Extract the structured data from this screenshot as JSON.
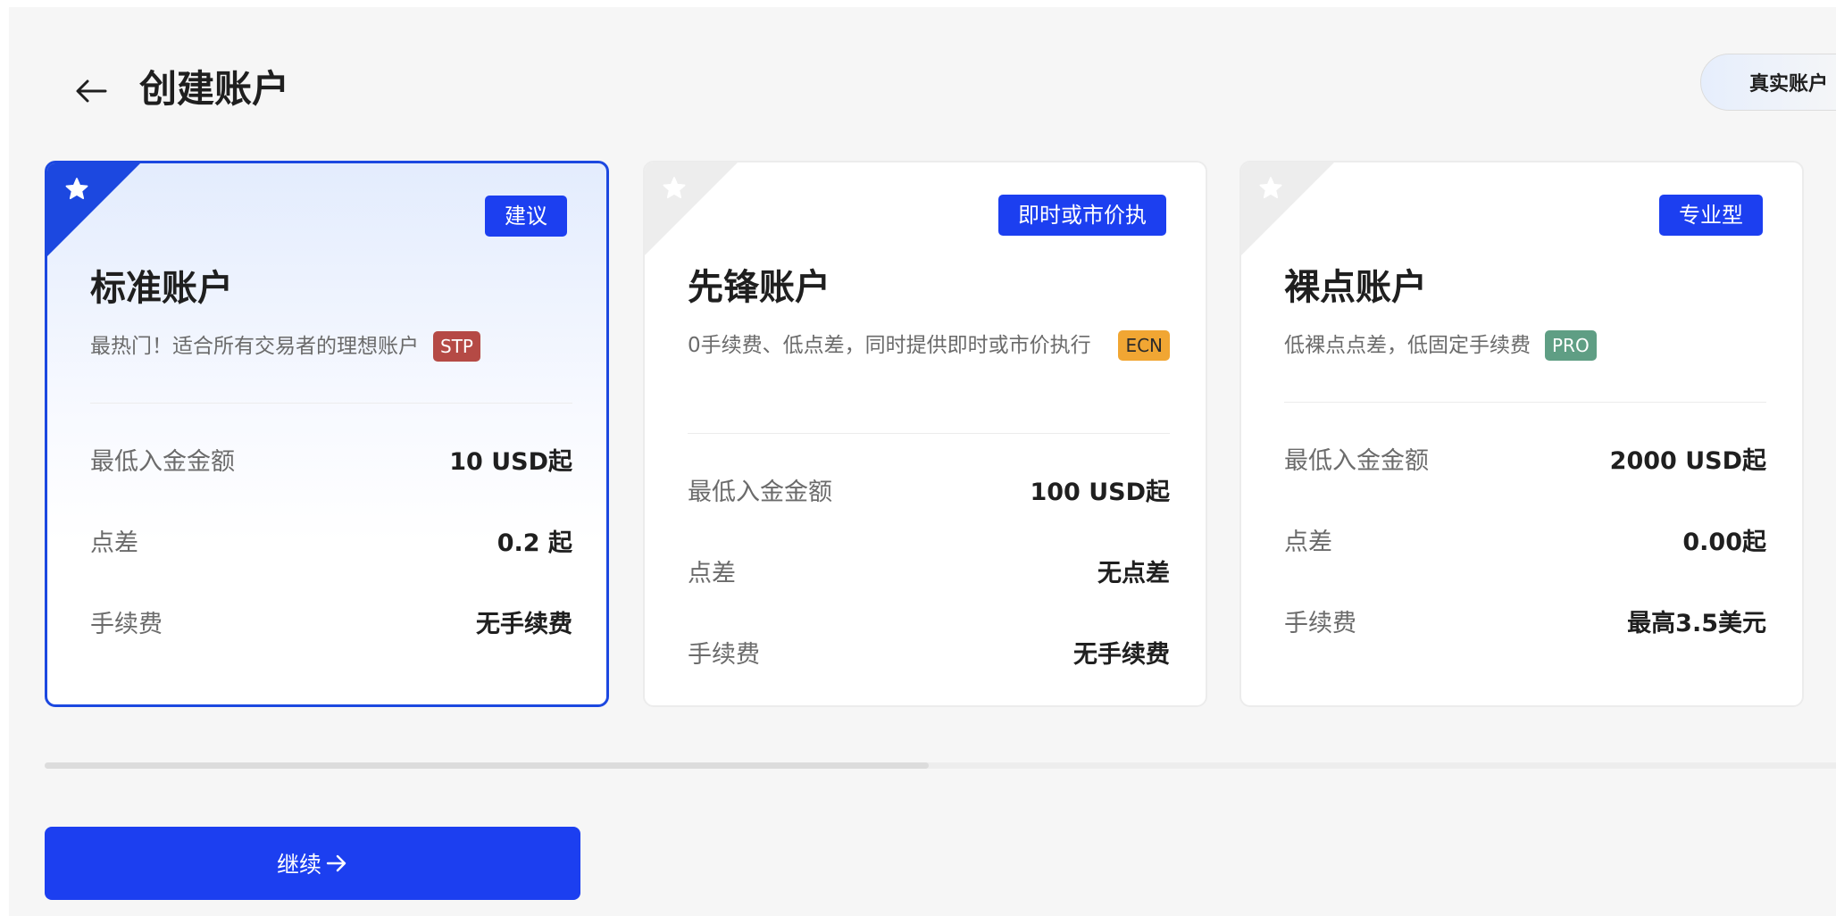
{
  "header": {
    "title": "创建账户",
    "account_type_label": "真实账户"
  },
  "cards": [
    {
      "tag": "建议",
      "title": "标准账户",
      "description": "最热门！适合所有交易者的理想账户",
      "badge": "STP",
      "rows": [
        {
          "label": "最低入金金额",
          "value": "10 USD起"
        },
        {
          "label": "点差",
          "value": "0.2 起"
        },
        {
          "label": "手续费",
          "value": "无手续费"
        }
      ],
      "selected": true
    },
    {
      "tag": "即时或市价执",
      "title": "先锋账户",
      "description": "0手续费、低点差，同时提供即时或市价执行",
      "badge": "ECN",
      "rows": [
        {
          "label": "最低入金金额",
          "value": "100 USD起"
        },
        {
          "label": "点差",
          "value": "无点差"
        },
        {
          "label": "手续费",
          "value": "无手续费"
        }
      ],
      "selected": false
    },
    {
      "tag": "专业型",
      "title": "裸点账户",
      "description": "低裸点点差，低固定手续费",
      "badge": "PRO",
      "rows": [
        {
          "label": "最低入金金额",
          "value": "2000 USD起"
        },
        {
          "label": "点差",
          "value": "0.00起"
        },
        {
          "label": "手续费",
          "value": "最高3.5美元"
        }
      ],
      "selected": false
    }
  ],
  "footer": {
    "continue_label": "继续"
  },
  "colors": {
    "accent": "#1c3ff0",
    "selected_border": "#1c48e0",
    "badge_stp": "#b54a45",
    "badge_ecn": "#f1a633",
    "badge_pro": "#5f9e84"
  },
  "icons": {
    "back": "arrow-left-icon",
    "corner": "star-icon",
    "continue": "arrow-right-icon"
  }
}
